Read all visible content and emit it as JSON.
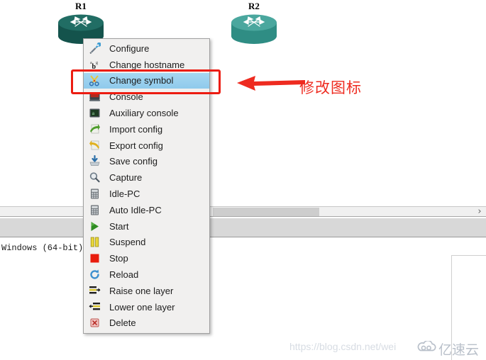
{
  "canvas": {
    "devices": [
      {
        "name": "R1",
        "icon": "router-icon",
        "color": "#1e6059"
      },
      {
        "name": "R2",
        "icon": "router-icon",
        "color": "#3d9b93"
      }
    ]
  },
  "context_menu": {
    "items": [
      {
        "label": "Configure",
        "icon": "configure-wrench-icon",
        "selected": false
      },
      {
        "label": "Change hostname",
        "icon": "rename-abc-icon",
        "selected": false
      },
      {
        "label": "Change symbol",
        "icon": "change-symbol-icon",
        "selected": true
      },
      {
        "label": "Console",
        "icon": "console-terminal-icon",
        "selected": false
      },
      {
        "label": "Auxiliary console",
        "icon": "aux-console-icon",
        "selected": false
      },
      {
        "label": "Import config",
        "icon": "import-config-icon",
        "selected": false
      },
      {
        "label": "Export config",
        "icon": "export-config-icon",
        "selected": false
      },
      {
        "label": "Save config",
        "icon": "save-config-icon",
        "selected": false
      },
      {
        "label": "Capture",
        "icon": "capture-magnifier-icon",
        "selected": false
      },
      {
        "label": "Idle-PC",
        "icon": "idle-pc-calculator-icon",
        "selected": false
      },
      {
        "label": "Auto Idle-PC",
        "icon": "auto-idle-pc-icon",
        "selected": false
      },
      {
        "label": "Start",
        "icon": "start-play-icon",
        "selected": false
      },
      {
        "label": "Suspend",
        "icon": "suspend-pause-icon",
        "selected": false
      },
      {
        "label": "Stop",
        "icon": "stop-square-icon",
        "selected": false
      },
      {
        "label": "Reload",
        "icon": "reload-refresh-icon",
        "selected": false
      },
      {
        "label": "Raise one layer",
        "icon": "raise-layer-icon",
        "selected": false
      },
      {
        "label": "Lower one layer",
        "icon": "lower-layer-icon",
        "selected": false
      },
      {
        "label": "Delete",
        "icon": "delete-x-icon",
        "selected": false
      }
    ]
  },
  "annotations": {
    "arrow_icon": "left-arrow-icon",
    "text": "修改图标",
    "color": "#ee2b20",
    "highlight_color": "#ec1c11"
  },
  "scrollbar": {
    "right_arrow_glyph": "›"
  },
  "console": {
    "text": "Windows (64-bit)."
  },
  "watermarks": {
    "url": "https://blog.csdn.net/wei",
    "logo_text": "亿速云",
    "logo_icon": "cloud-icon"
  }
}
